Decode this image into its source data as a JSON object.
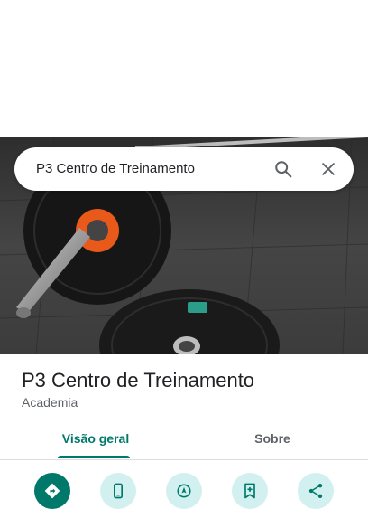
{
  "search": {
    "query": "P3 Centro de Treinamento"
  },
  "place": {
    "name": "P3 Centro de Treinamento",
    "category": "Academia"
  },
  "tabs": [
    {
      "label": "Visão geral",
      "active": true
    },
    {
      "label": "Sobre",
      "active": false
    }
  ],
  "actions": [
    {
      "icon": "directions-icon"
    },
    {
      "icon": "phone-icon"
    },
    {
      "icon": "navigate-icon"
    },
    {
      "icon": "save-icon"
    },
    {
      "icon": "share-icon"
    }
  ],
  "colors": {
    "accent": "#00796b",
    "action_bg": "#d2f0f0"
  }
}
